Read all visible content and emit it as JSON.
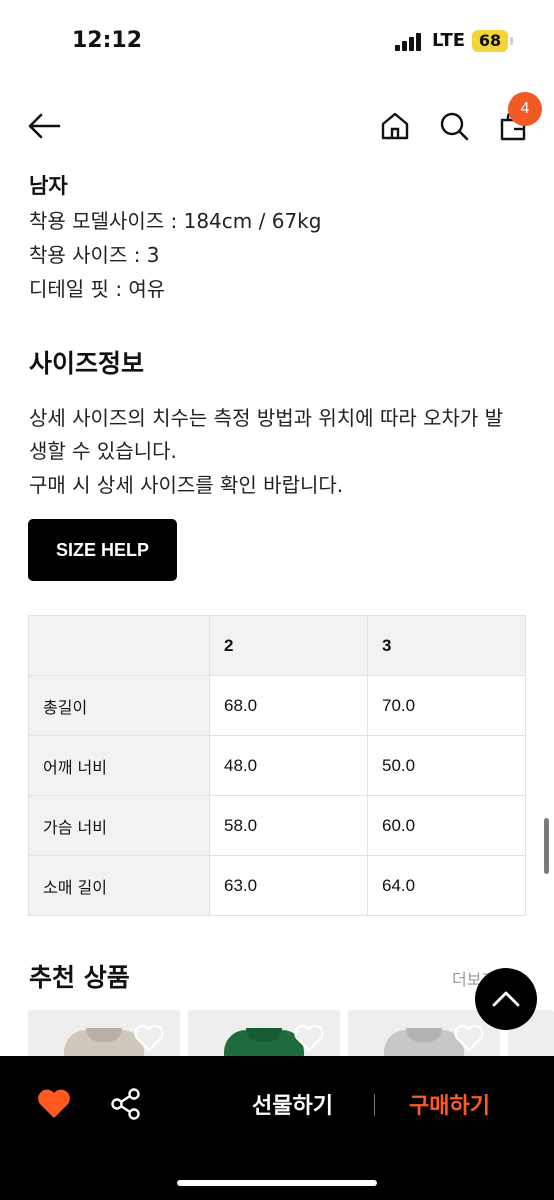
{
  "status_bar": {
    "time": "12:12",
    "network": "LTE",
    "battery": "68",
    "battery_color": "#f3d53a"
  },
  "header": {
    "back_icon": "arrow-left-icon",
    "home_icon": "home-icon",
    "search_icon": "search-icon",
    "cart_icon": "shopping-bag-icon",
    "cart_count": "4",
    "badge_color": "#f15a22"
  },
  "model_info": {
    "gender": "남자",
    "lines": [
      "착용 모델사이즈 : 184cm / 67kg",
      "착용 사이즈 : 3",
      "디테일 핏 : 여유"
    ]
  },
  "size_info": {
    "title": "사이즈정보",
    "description": [
      "상세 사이즈의 치수는 측정 방법과 위치에 따라 오차가 발",
      "생할 수 있습니다.",
      "구매 시 상세 사이즈를 확인 바랍니다."
    ],
    "help_button": "SIZE HELP",
    "columns": [
      "",
      "2",
      "3"
    ],
    "rows": [
      {
        "label": "총길이",
        "values": [
          "68.0",
          "70.0"
        ]
      },
      {
        "label": "어깨 너비",
        "values": [
          "48.0",
          "50.0"
        ]
      },
      {
        "label": "가슴 너비",
        "values": [
          "58.0",
          "60.0"
        ]
      },
      {
        "label": "소매 길이",
        "values": [
          "63.0",
          "64.0"
        ]
      }
    ]
  },
  "recommended": {
    "title": "추천 상품",
    "more": "더보기",
    "products": [
      {
        "color": "#cfc6bc"
      },
      {
        "color": "#1f6b3d"
      },
      {
        "color": "#c6c6c6"
      }
    ]
  },
  "bottom_bar": {
    "like_icon": "heart-icon",
    "share_icon": "share-icon",
    "gift": "선물하기",
    "buy": "구매하기",
    "like_color": "#ff5a1f",
    "buy_color": "#ff5a1f"
  }
}
